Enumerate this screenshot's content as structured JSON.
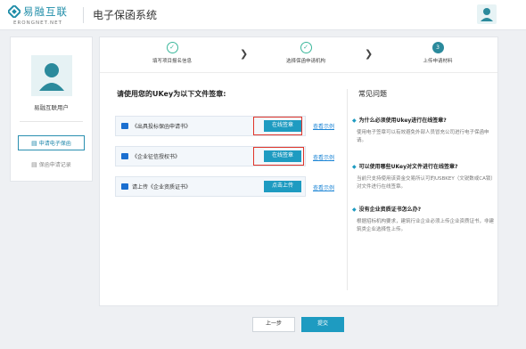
{
  "header": {
    "logo_cn": "易融互联",
    "logo_en": "ERONGNET.NET",
    "system_title": "电子保函系统",
    "user_icon": "user-avatar-icon"
  },
  "sidebar": {
    "user_name": "易融互联用户",
    "items": [
      {
        "label": "申请电子保函",
        "icon": "document-icon",
        "active": true
      },
      {
        "label": "保函申请记录",
        "icon": "record-icon",
        "active": false
      }
    ]
  },
  "steps": [
    {
      "label": "填写项目报名信息",
      "state": "done",
      "mark": "✓"
    },
    {
      "label": "选择保函申请机构",
      "state": "done",
      "mark": "✓"
    },
    {
      "label": "上传申请材料",
      "state": "current",
      "mark": "3"
    }
  ],
  "sign_section": {
    "title": "请使用您的UKey为以下文件签章:",
    "documents": [
      {
        "name": "《出具投标保函申请书》",
        "button": "在线签章",
        "example": "查看示例"
      },
      {
        "name": "《企业征信授权书》",
        "button": "在线签章",
        "example": "查看示例"
      },
      {
        "name": "请上传《企业资质证书》",
        "button": "点击上传",
        "example": "查看示例"
      }
    ]
  },
  "faq": {
    "title": "常见问题",
    "items": [
      {
        "q": "为什么必须使用Ukey进行在线签章?",
        "a": "使用电子签章可以有效避免外部人员冒充公司进行电子保函申请。"
      },
      {
        "q": "可以使用哪些UKey对文件进行在线签章?",
        "a": "当前只支持使用该资金交易所认可的USBKEY（文锐数或CA锁）对文件进行在线签章。"
      },
      {
        "q": "没有企业资质证书怎么办?",
        "a": "根据招标机构要求，建筑行业企业必须上传企业资质证书，非建筑类企业选择性上传。"
      }
    ]
  },
  "footer": {
    "prev_label": "上一步",
    "submit_label": "提交"
  },
  "colors": {
    "accent": "#1e9bc1",
    "highlight_frame": "#e0342a",
    "step_done": "#3bb79b"
  }
}
